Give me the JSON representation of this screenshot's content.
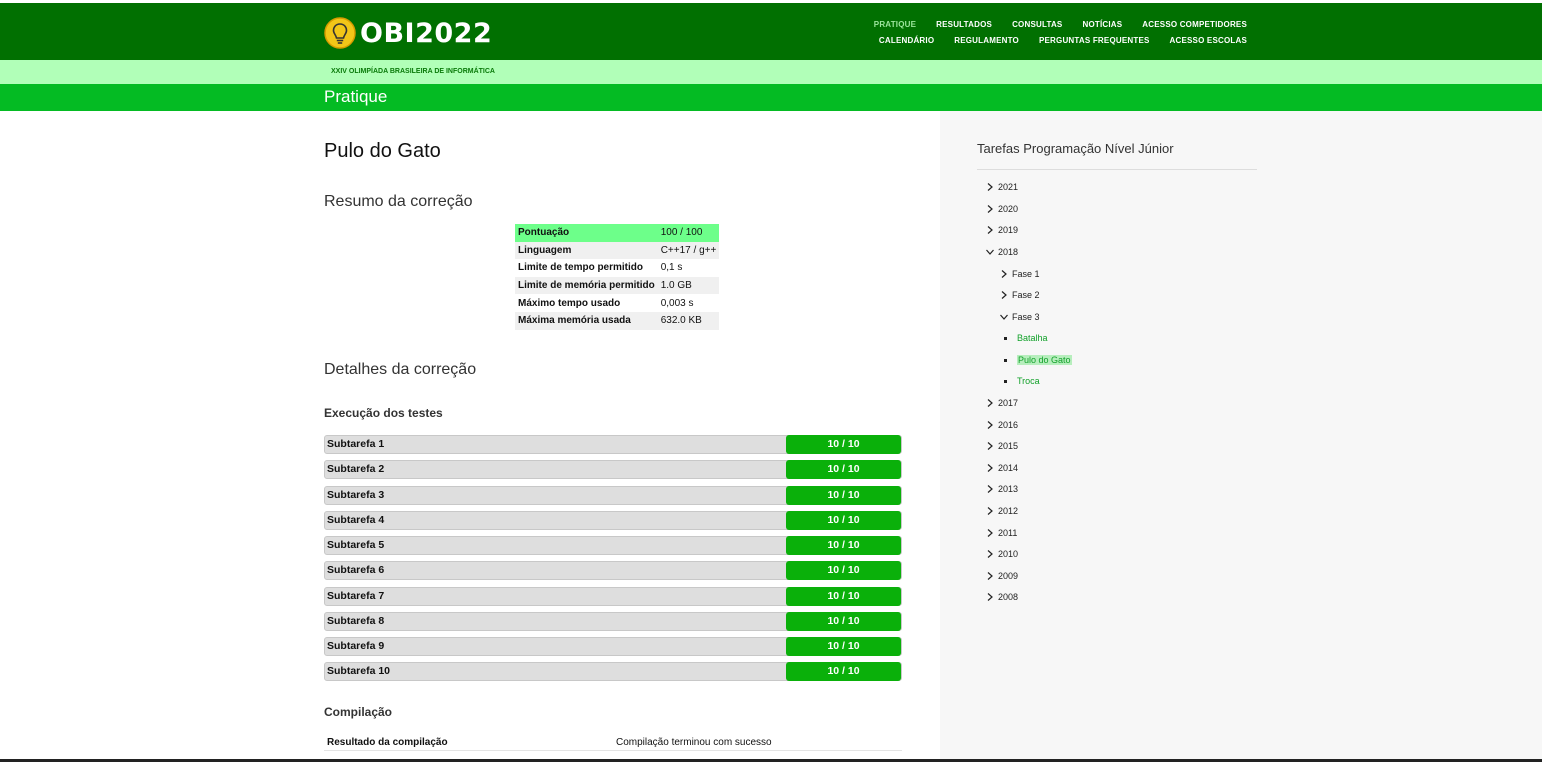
{
  "header": {
    "logo_text": "OBI2022",
    "nav_row1": [
      "PRATIQUE",
      "RESULTADOS",
      "CONSULTAS",
      "NOTÍCIAS",
      "ACESSO COMPETIDORES"
    ],
    "nav_row2": [
      "CALENDÁRIO",
      "REGULAMENTO",
      "PERGUNTAS FREQUENTES",
      "ACESSO ESCOLAS"
    ],
    "subtitle": "XXIV OLIMPÍADA BRASILEIRA DE INFORMÁTICA",
    "page_section": "Pratique"
  },
  "colors": {
    "header_bg": "#017001",
    "subheader_bg": "#b1ffb8",
    "titlebar_bg": "#04bb23",
    "score_green": "#0ab00a",
    "highlight_row": "#6dff8a"
  },
  "main": {
    "problem_title": "Pulo do Gato",
    "summary_heading": "Resumo da correção",
    "summary": [
      {
        "label": "Pontuação",
        "value": "100 / 100"
      },
      {
        "label": "Linguagem",
        "value": "C++17 / g++"
      },
      {
        "label": "Limite de tempo permitido",
        "value": "0,1 s"
      },
      {
        "label": "Limite de memória permitido",
        "value": "1.0 GB"
      },
      {
        "label": "Máximo tempo usado",
        "value": "0,003 s"
      },
      {
        "label": "Máxima memória usada",
        "value": "632.0 KB"
      }
    ],
    "details_heading": "Detalhes da correção",
    "tests_heading": "Execução dos testes",
    "subtasks": [
      {
        "name": "Subtarefa 1",
        "score": "10 / 10"
      },
      {
        "name": "Subtarefa 2",
        "score": "10 / 10"
      },
      {
        "name": "Subtarefa 3",
        "score": "10 / 10"
      },
      {
        "name": "Subtarefa 4",
        "score": "10 / 10"
      },
      {
        "name": "Subtarefa 5",
        "score": "10 / 10"
      },
      {
        "name": "Subtarefa 6",
        "score": "10 / 10"
      },
      {
        "name": "Subtarefa 7",
        "score": "10 / 10"
      },
      {
        "name": "Subtarefa 8",
        "score": "10 / 10"
      },
      {
        "name": "Subtarefa 9",
        "score": "10 / 10"
      },
      {
        "name": "Subtarefa 10",
        "score": "10 / 10"
      }
    ],
    "compile_heading": "Compilação",
    "compile_label": "Resultado da compilação",
    "compile_value": "Compilação terminou com sucesso"
  },
  "sidebar": {
    "title": "Tarefas Programação Nível Júnior",
    "tree": [
      {
        "label": "2021",
        "level": 0,
        "type": "collapsed"
      },
      {
        "label": "2020",
        "level": 0,
        "type": "collapsed"
      },
      {
        "label": "2019",
        "level": 0,
        "type": "collapsed"
      },
      {
        "label": "2018",
        "level": 0,
        "type": "expanded"
      },
      {
        "label": "Fase 1",
        "level": 1,
        "type": "collapsed"
      },
      {
        "label": "Fase 2",
        "level": 1,
        "type": "collapsed"
      },
      {
        "label": "Fase 3",
        "level": 1,
        "type": "expanded"
      },
      {
        "label": "Batalha",
        "level": 2,
        "type": "leaf"
      },
      {
        "label": "Pulo do Gato",
        "level": 2,
        "type": "leaf",
        "active": true
      },
      {
        "label": "Troca",
        "level": 2,
        "type": "leaf"
      },
      {
        "label": "2017",
        "level": 0,
        "type": "collapsed"
      },
      {
        "label": "2016",
        "level": 0,
        "type": "collapsed"
      },
      {
        "label": "2015",
        "level": 0,
        "type": "collapsed"
      },
      {
        "label": "2014",
        "level": 0,
        "type": "collapsed"
      },
      {
        "label": "2013",
        "level": 0,
        "type": "collapsed"
      },
      {
        "label": "2012",
        "level": 0,
        "type": "collapsed"
      },
      {
        "label": "2011",
        "level": 0,
        "type": "collapsed"
      },
      {
        "label": "2010",
        "level": 0,
        "type": "collapsed"
      },
      {
        "label": "2009",
        "level": 0,
        "type": "collapsed"
      },
      {
        "label": "2008",
        "level": 0,
        "type": "collapsed"
      }
    ]
  }
}
